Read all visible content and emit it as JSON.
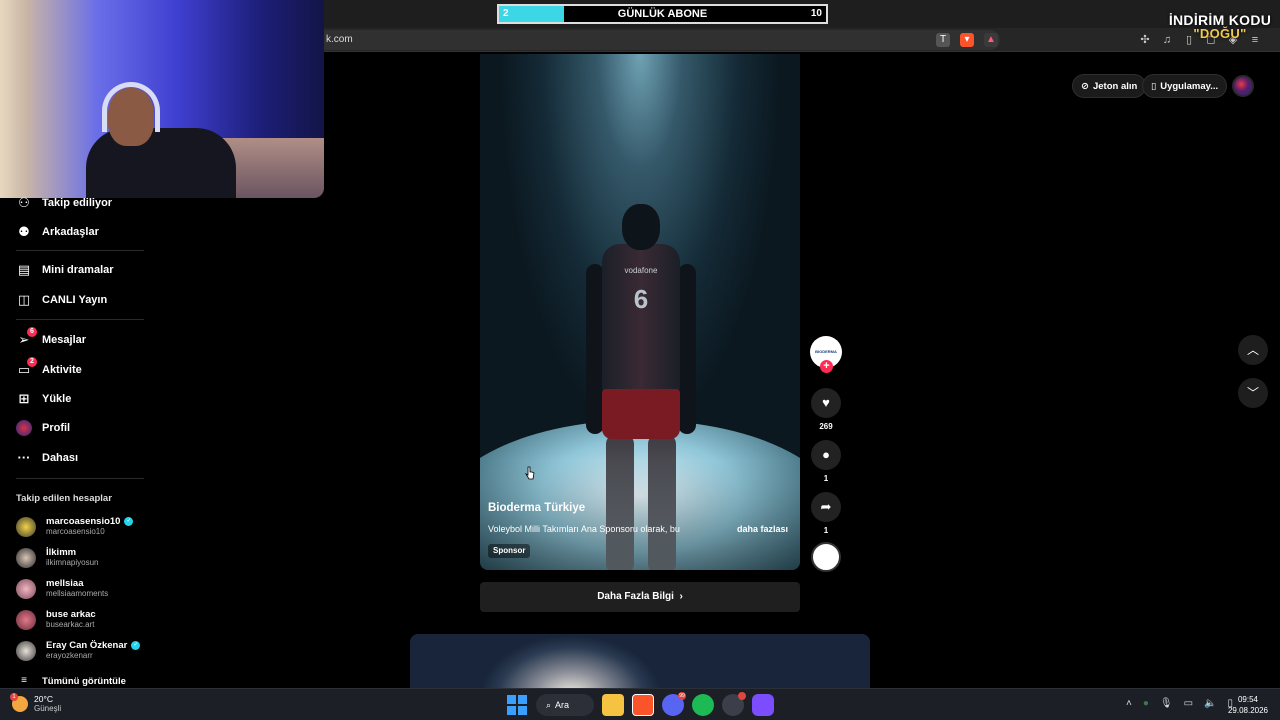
{
  "browser": {
    "url": "k.com"
  },
  "overlay": {
    "goal_start": "2",
    "goal_label": "GÜNLÜK ABONE",
    "goal_end": "10",
    "goal_progress": 0.2,
    "promo_title": "İNDİRİM KODU",
    "promo_code": "\"DOĞU\""
  },
  "sidebar": {
    "nav": [
      {
        "label": "Takip ediliyor",
        "icon": "following-icon"
      },
      {
        "label": "Arkadaşlar",
        "icon": "friends-icon"
      },
      {
        "label": "Mini dramalar",
        "icon": "film-icon"
      },
      {
        "label": "CANLI Yayın",
        "icon": "live-tv-icon"
      },
      {
        "label": "Mesajlar",
        "icon": "messages-icon",
        "badge": "6"
      },
      {
        "label": "Aktivite",
        "icon": "activity-icon",
        "badge": "2"
      },
      {
        "label": "Yükle",
        "icon": "upload-icon"
      },
      {
        "label": "Profil",
        "icon": "profile-icon"
      },
      {
        "label": "Dahası",
        "icon": "more-icon"
      }
    ],
    "following_title": "Takip edilen hesaplar",
    "accounts": [
      {
        "name": "marcoasensio10",
        "handle": "marcoasensio10",
        "verified": true
      },
      {
        "name": "İlkimm",
        "handle": "ilkimnapiyosun",
        "verified": false
      },
      {
        "name": "mellsiaa",
        "handle": "mellsiaamoments",
        "verified": false
      },
      {
        "name": "buse arkac",
        "handle": "busearkac.art",
        "verified": false
      },
      {
        "name": "Eray Can Özkenar",
        "handle": "erayozkenarr",
        "verified": true
      }
    ],
    "see_all": "Tümünü görüntüle"
  },
  "header": {
    "coins": "Jeton alın",
    "app": "Uygulamay..."
  },
  "video": {
    "author": "Bioderma Türkiye",
    "description": "Voleybol Milli Takımları Ana Sponsoru olarak, bu",
    "more": "daha fazlası",
    "sponsor_tag": "Sponsor",
    "jersey_number": "6",
    "jersey_sponsor": "vodafone",
    "learn_more": "Daha Fazla Bilgi",
    "author_avatar_text": "BIODERMA"
  },
  "actions": {
    "likes": "269",
    "comments": "1",
    "shares": "1"
  },
  "taskbar": {
    "temperature": "20°C",
    "weather": "Güneşli",
    "search": "Ara",
    "time": "09:54",
    "date": "29.08.2026",
    "discord_badge": "99"
  }
}
